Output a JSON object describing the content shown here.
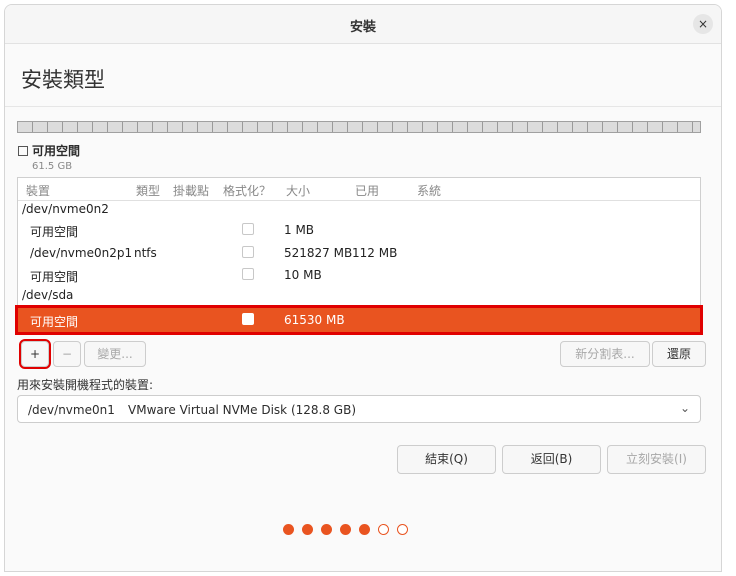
{
  "window": {
    "title": "安裝",
    "close_label": "×"
  },
  "page_title": "安裝類型",
  "legend": {
    "label": "可用空間",
    "size": "61.5 GB"
  },
  "table": {
    "headers": [
      "裝置",
      "類型",
      "掛載點",
      "格式化？",
      "大小",
      "已用",
      "系統"
    ],
    "rows": [
      {
        "device": "/dev/nvme0n2",
        "type": "",
        "mount": "",
        "format": null,
        "size": "",
        "used": "",
        "system": "",
        "is_disk": true
      },
      {
        "device": "可用空間",
        "type": "",
        "mount": "",
        "format": false,
        "size": "1 MB",
        "used": "",
        "system": ""
      },
      {
        "device": "/dev/nvme0n2p1",
        "type": "ntfs",
        "mount": "",
        "format": false,
        "size": "521827 MB",
        "used": "112 MB",
        "system": ""
      },
      {
        "device": "可用空間",
        "type": "",
        "mount": "",
        "format": false,
        "size": "10 MB",
        "used": "",
        "system": ""
      },
      {
        "device": "/dev/sda",
        "type": "",
        "mount": "",
        "format": null,
        "size": "",
        "used": "",
        "system": "",
        "is_disk": true
      },
      {
        "device": "可用空間",
        "type": "",
        "mount": "",
        "format": false,
        "size": "61530 MB",
        "used": "",
        "system": "",
        "selected": true
      }
    ]
  },
  "toolbar": {
    "add_label": "+",
    "remove_label": "−",
    "change_label": "變更...",
    "new_table_label": "新分割表...",
    "revert_label": "還原"
  },
  "bootloader": {
    "label": "用來安裝開機程式的裝置:",
    "device": "/dev/nvme0n1",
    "description": "VMware Virtual NVMe Disk (128.8 GB)"
  },
  "buttons": {
    "quit": "結束(Q)",
    "back": "返回(B)",
    "install": "立刻安裝(I)"
  },
  "progress": {
    "total_steps": 7,
    "completed_steps": 5
  },
  "colors": {
    "accent": "#e95420",
    "highlight": "#e00000"
  }
}
